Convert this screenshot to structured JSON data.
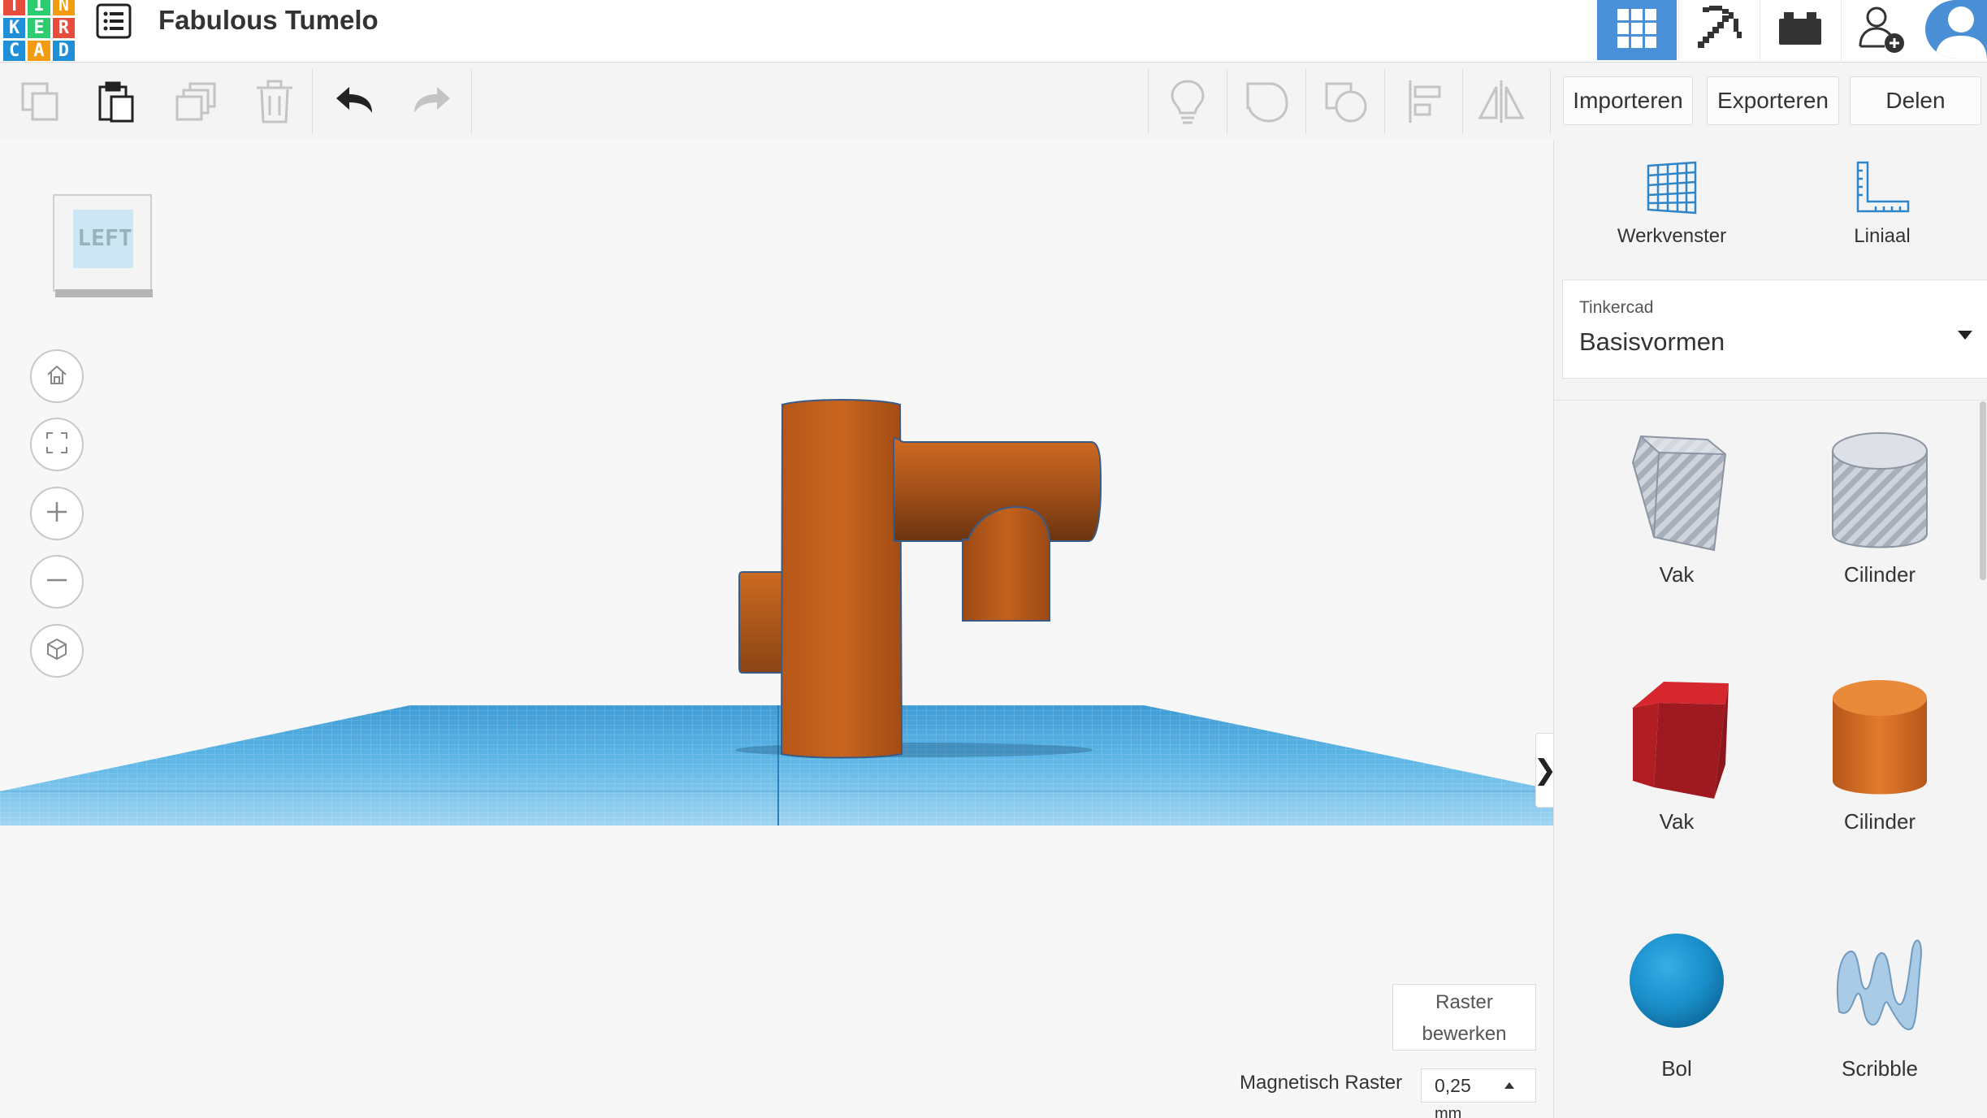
{
  "header": {
    "logo_letters": [
      "T",
      "I",
      "N",
      "K",
      "E",
      "R",
      "C",
      "A",
      "D"
    ],
    "logo_colors": [
      "#e74c3c",
      "#2ecc71",
      "#f39c12",
      "#1f8fd8",
      "#2ecc71",
      "#e74c3c",
      "#1f8fd8",
      "#f39c12",
      "#1f8fd8"
    ],
    "menu_icon": "list-icon",
    "design_title": "Fabulous Tumelo",
    "view_3d_icon": "grid-icon",
    "pickaxe_icon": "pickaxe-icon",
    "bricks_icon": "bricks-icon",
    "add_user_icon": "add-user-icon",
    "accent": "#4a90d9"
  },
  "toolbar": {
    "tools": [
      "copy-icon",
      "paste-icon",
      "duplicate-icon",
      "delete-icon",
      "undo-icon",
      "redo-icon"
    ],
    "right_tools": [
      "lightbulb-icon",
      "group-icon",
      "ungroup-icon",
      "align-icon",
      "mirror-icon"
    ],
    "import_label": "Importeren",
    "export_label": "Exporteren",
    "share_label": "Delen"
  },
  "viewport": {
    "viewcube_face": "LEFT",
    "nav": [
      "home-icon",
      "fit-view-icon",
      "zoom-in-icon",
      "zoom-out-icon",
      "ortho-icon"
    ],
    "raster_edit_label": "Raster bewerken",
    "snap_label": "Magnetisch Raster",
    "snap_value": "0,25",
    "snap_unit": "mm",
    "object_color": "#c8621e",
    "workplane_color": "#5ab5e8",
    "collapse_glyph": "❯"
  },
  "panel": {
    "workplane_label": "Werkvenster",
    "ruler_label": "Liniaal",
    "library_provider": "Tinkercad",
    "library_name": "Basisvormen",
    "shapes": [
      {
        "label": "Vak",
        "icon": "hole-box-icon"
      },
      {
        "label": "Cilinder",
        "icon": "hole-cylinder-icon"
      },
      {
        "label": "Vak",
        "icon": "box-icon"
      },
      {
        "label": "Cilinder",
        "icon": "cylinder-icon"
      },
      {
        "label": "Bol",
        "icon": "sphere-icon"
      },
      {
        "label": "Scribble",
        "icon": "scribble-icon"
      }
    ]
  }
}
